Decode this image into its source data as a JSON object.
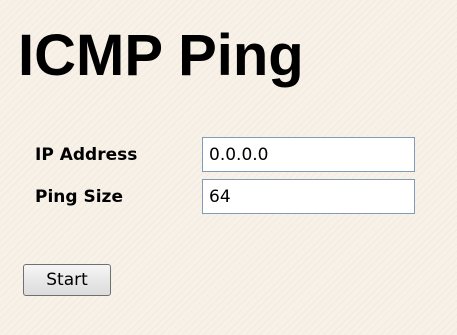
{
  "page": {
    "title": "ICMP Ping"
  },
  "form": {
    "ip_address": {
      "label": "IP Address",
      "value": "0.0.0.0"
    },
    "ping_size": {
      "label": "Ping Size",
      "value": "64"
    }
  },
  "actions": {
    "start_label": "Start"
  }
}
